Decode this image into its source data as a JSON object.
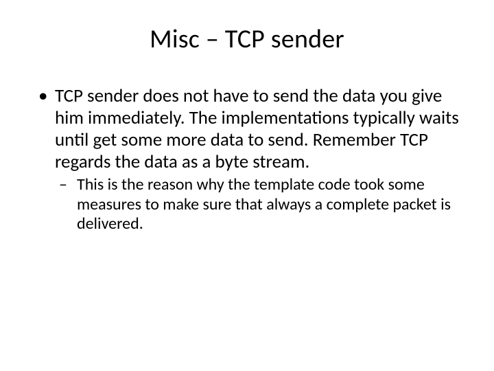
{
  "slide": {
    "title": "Misc – TCP sender",
    "bullets": [
      {
        "text": "TCP sender does not have to send the data you give him immediately. The implementations typically waits until get some more data to send. Remember TCP regards the data as a byte stream.",
        "children": [
          {
            "text": "This is the reason why the template code took some measures to make sure that always a complete packet is delivered."
          }
        ]
      }
    ]
  }
}
